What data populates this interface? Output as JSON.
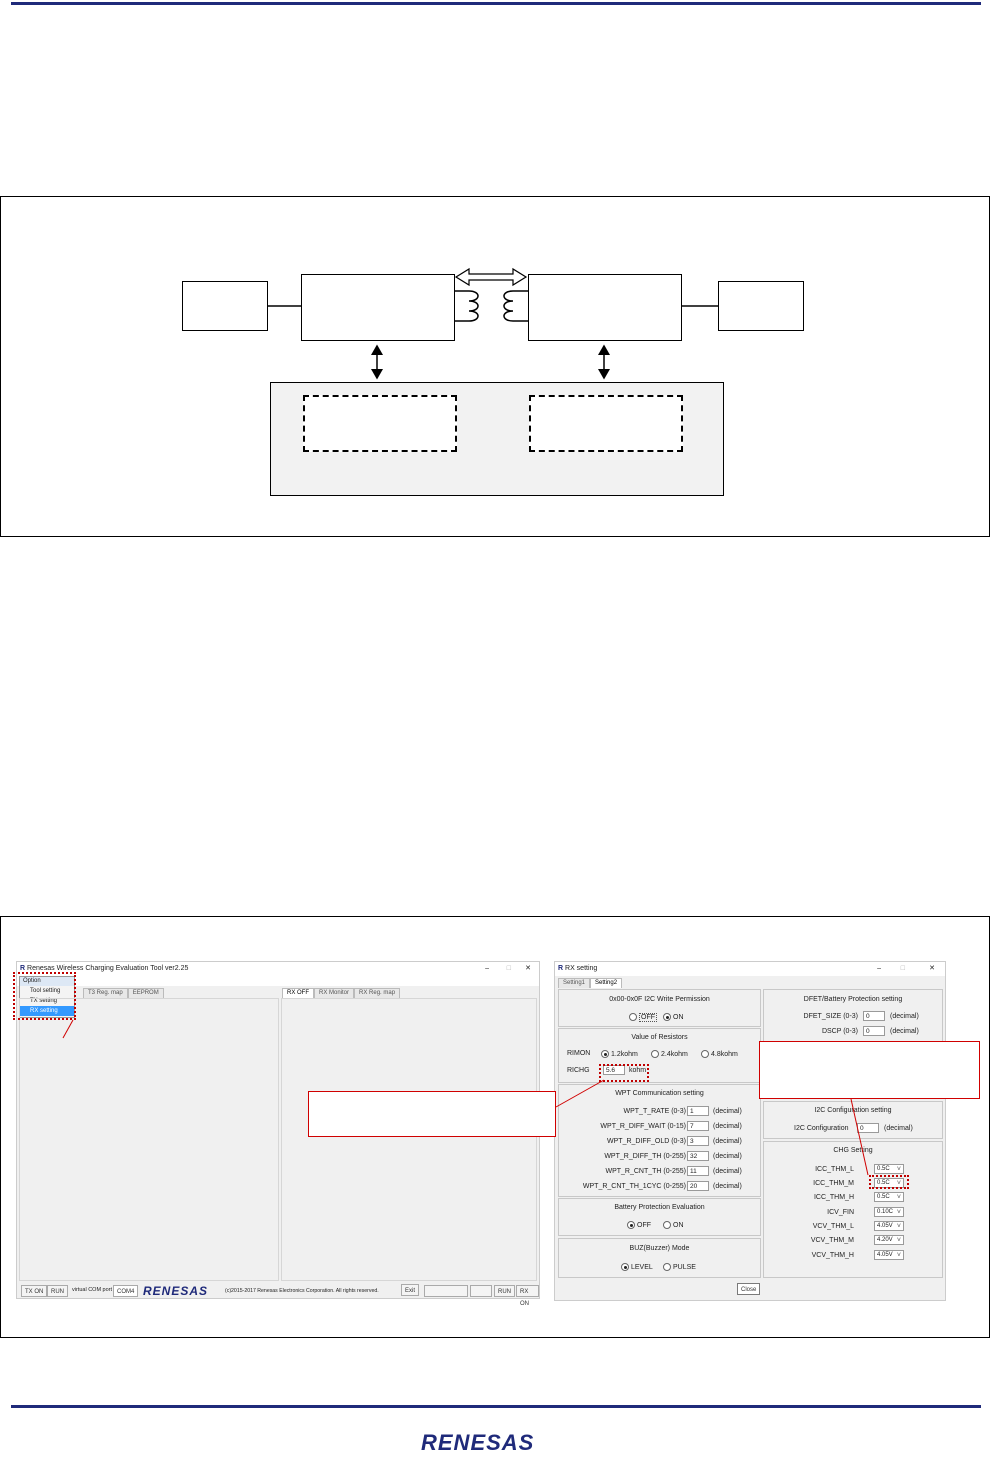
{
  "rx_window": {
    "title": "RX setting",
    "tabs": [
      "Setting1",
      "Setting2"
    ],
    "i2c_write": {
      "title": "0x00-0x0F I2C Write Permission",
      "off": "OFF",
      "on": "ON"
    },
    "resistors": {
      "title": "Value of Resistors",
      "rimon_label": "RIMON",
      "opt1": "1.2kohm",
      "opt2": "2.4kohm",
      "opt3": "4.8kohm",
      "richg_label": "RICHG",
      "richg_value": "5.6",
      "richg_unit": "kohm"
    },
    "wpt": {
      "title": "WPT Communication setting",
      "rows": [
        {
          "label": "WPT_T_RATE (0-3)",
          "value": "1",
          "unit": "(decimal)"
        },
        {
          "label": "WPT_R_DIFF_WAIT (0-15)",
          "value": "7",
          "unit": "(decimal)"
        },
        {
          "label": "WPT_R_DIFF_OLD (0-3)",
          "value": "3",
          "unit": "(decimal)"
        },
        {
          "label": "WPT_R_DIFF_TH (0-255)",
          "value": "32",
          "unit": "(decimal)"
        },
        {
          "label": "WPT_R_CNT_TH (0-255)",
          "value": "11",
          "unit": "(decimal)"
        },
        {
          "label": "WPT_R_CNT_TH_1CYC (0-255)",
          "value": "20",
          "unit": "(decimal)"
        }
      ]
    },
    "battery_eval": {
      "title": "Battery Protection Evaluation",
      "off": "OFF",
      "on": "ON"
    },
    "buz": {
      "title": "BUZ(Buzzer) Mode",
      "level": "LEVEL",
      "pulse": "PULSE"
    },
    "dfet": {
      "title": "DFET/Battery Protection setting",
      "rows": [
        {
          "label": "DFET_SIZE (0-3)",
          "value": "0",
          "unit": "(decimal)"
        },
        {
          "label": "DSCP (0-3)",
          "value": "0",
          "unit": "(decimal)"
        }
      ]
    },
    "i2c_conf": {
      "title": "I2C Configuration setting",
      "label": "I2C Configuration",
      "value": "0",
      "unit": "(decimal)"
    },
    "chg": {
      "title": "CHG Setting",
      "rows": [
        {
          "label": "ICC_THM_L",
          "value": "0.5C"
        },
        {
          "label": "ICC_THM_M",
          "value": "0.5C"
        },
        {
          "label": "ICC_THM_H",
          "value": "0.5C"
        },
        {
          "label": "ICV_FIN",
          "value": "0.10C"
        },
        {
          "label": "VCV_THM_L",
          "value": "4.05V"
        },
        {
          "label": "VCV_THM_M",
          "value": "4.20V"
        },
        {
          "label": "VCV_THM_H",
          "value": "4.05V"
        }
      ]
    },
    "close": "Close"
  },
  "main_window": {
    "title": "Renesas Wireless Charging Evaluation Tool ver2.25",
    "menu": {
      "option": "Option",
      "items": [
        "Tool setting",
        "TX setting",
        "RX setting"
      ]
    },
    "left_tabs": [
      "T3 Reg. map",
      "EEPROM"
    ],
    "right_tabs": [
      "RX OFF",
      "RX Monitor",
      "RX Reg. map"
    ],
    "status": {
      "tx_on": "TX ON",
      "run": "RUN",
      "port_label": "virtual COM port",
      "port": "COM4",
      "copyright": "(c)2015-2017 Renesas Electronics Corporation. All rights reserved.",
      "exit": "Exit",
      "run2": "RUN",
      "rx_on": "RX ON"
    },
    "logo": "RENESAS"
  },
  "footer": {
    "logo": "RENESAS"
  },
  "colors": {
    "rule": "#1f2a7a",
    "callout": "#d00000"
  }
}
